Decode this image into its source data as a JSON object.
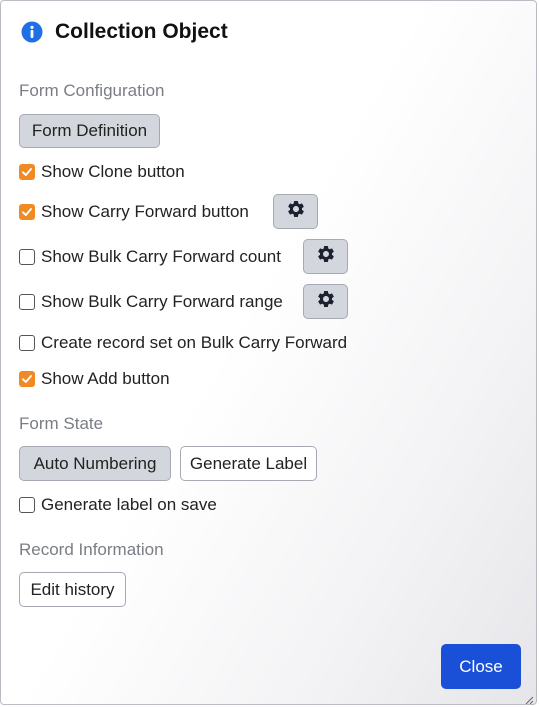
{
  "dialog": {
    "title": "Collection Object",
    "info_icon": "info-circle-icon",
    "accent_color": "#f08a22",
    "primary_color": "#1a4fd8"
  },
  "form_configuration": {
    "heading": "Form Configuration",
    "form_definition_label": "Form Definition",
    "options": [
      {
        "label": "Show Clone button",
        "checked": true
      },
      {
        "label": "Show Carry Forward button",
        "checked": true,
        "has_settings": true
      },
      {
        "label": "Show Bulk Carry Forward count",
        "checked": false,
        "has_settings": true
      },
      {
        "label": "Show Bulk Carry Forward range",
        "checked": false,
        "has_settings": true
      },
      {
        "label": "Create record set on Bulk Carry Forward",
        "checked": false
      },
      {
        "label": "Show Add button",
        "checked": true
      }
    ]
  },
  "form_state": {
    "heading": "Form State",
    "auto_numbering_label": "Auto Numbering",
    "generate_label_label": "Generate Label",
    "generate_on_save": {
      "label": "Generate label on save",
      "checked": false
    }
  },
  "record_information": {
    "heading": "Record Information",
    "edit_history_label": "Edit history"
  },
  "footer": {
    "close_label": "Close"
  }
}
